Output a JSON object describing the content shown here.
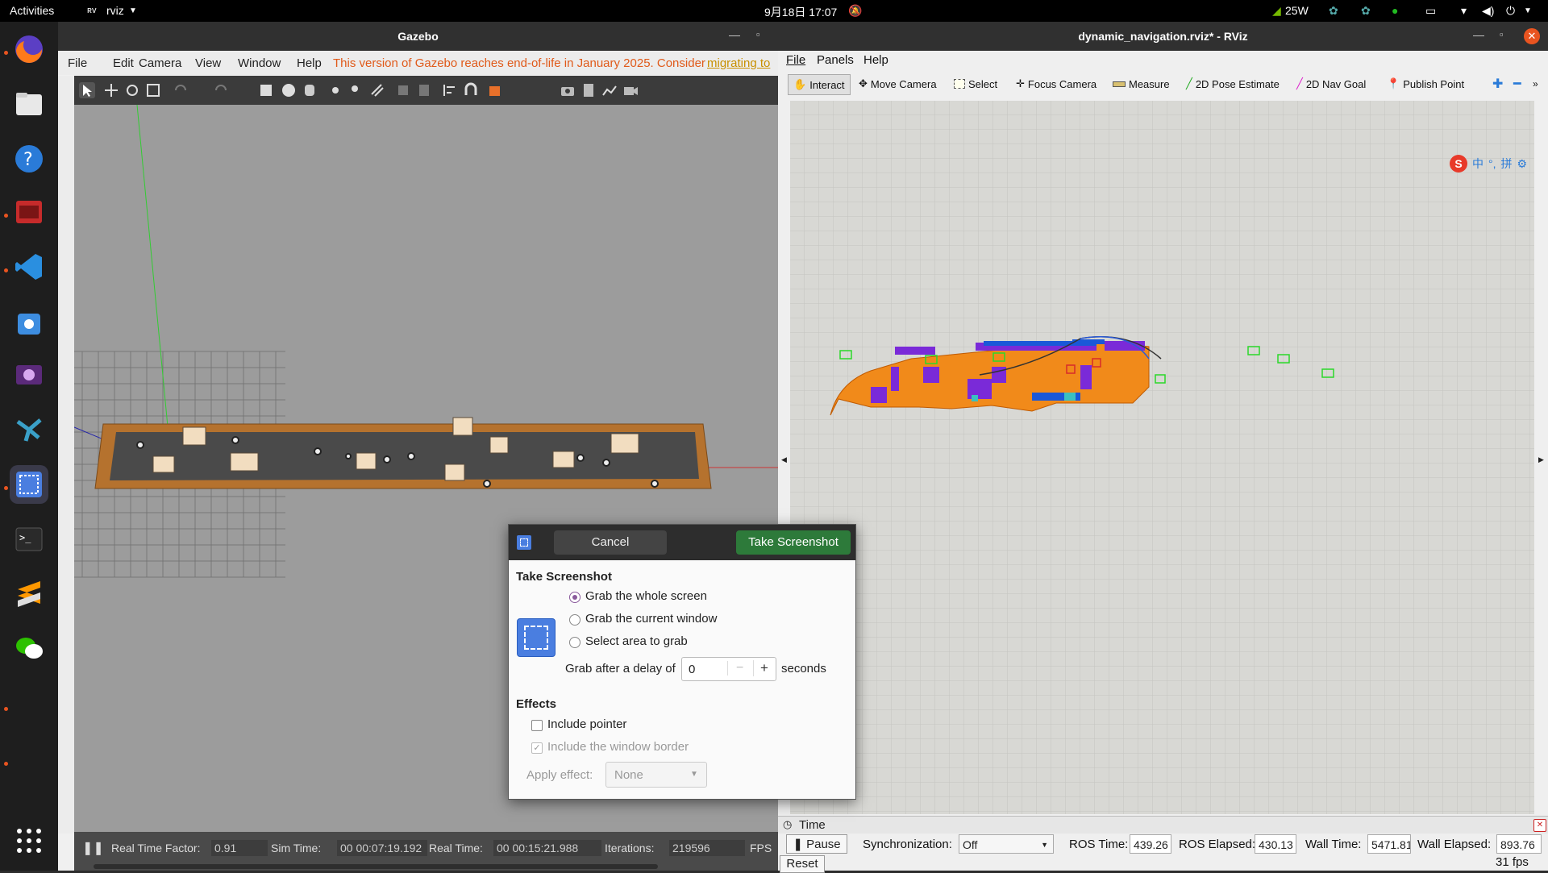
{
  "topbar": {
    "activities": "Activities",
    "app_name": "rviz",
    "clock": "9月18日 17:07",
    "power": "25W"
  },
  "dock": {
    "items": [
      "firefox-icon",
      "files-icon",
      "help-icon",
      "terminal-red-icon",
      "vscode-icon",
      "software-store-icon",
      "media-player-icon",
      "network-app-icon",
      "screenshot-icon",
      "terminal-icon",
      "sublime-icon",
      "wechat-icon",
      "apps-grid-icon"
    ]
  },
  "gazebo": {
    "title": "Gazebo",
    "menu": [
      "File",
      "Edit",
      "Camera",
      "View",
      "Window",
      "Help"
    ],
    "eol_notice": "This version of Gazebo reaches end-of-life in January 2025. Consider",
    "eol_link": "migrating to",
    "status": {
      "rtf_label": "Real Time Factor:",
      "rtf_value": "0.91",
      "sim_label": "Sim Time:",
      "sim_value": "00 00:07:19.192",
      "real_label": "Real Time:",
      "real_value": "00 00:15:21.988",
      "iter_label": "Iterations:",
      "iter_value": "219596",
      "fps_label": "FPS"
    }
  },
  "rviz": {
    "title": "dynamic_navigation.rviz* - RViz",
    "menu": [
      "File",
      "Panels",
      "Help"
    ],
    "tools": [
      "Interact",
      "Move Camera",
      "Select",
      "Focus Camera",
      "Measure",
      "2D Pose Estimate",
      "2D Nav Goal",
      "Publish Point"
    ],
    "time_panel": {
      "title": "Time",
      "pause": "Pause",
      "sync_label": "Synchronization:",
      "sync_value": "Off",
      "ros_time_label": "ROS Time:",
      "ros_time": "439.26",
      "ros_elapsed_label": "ROS Elapsed:",
      "ros_elapsed": "430.13",
      "wall_time_label": "Wall Time:",
      "wall_time": "5471.81",
      "wall_elapsed_label": "Wall Elapsed:",
      "wall_elapsed": "893.76",
      "reset": "Reset",
      "fps": "31 fps"
    },
    "ime": [
      "中",
      "°,",
      "拼"
    ]
  },
  "dialog": {
    "cancel": "Cancel",
    "take": "Take Screenshot",
    "section1": "Take Screenshot",
    "opt_whole": "Grab the whole screen",
    "opt_window": "Grab the current window",
    "opt_area": "Select area to grab",
    "delay_label": "Grab after a delay of",
    "delay_value": "0",
    "seconds": "seconds",
    "section2": "Effects",
    "include_pointer": "Include pointer",
    "include_border": "Include the window border",
    "apply_effect": "Apply effect:",
    "effect_value": "None"
  }
}
